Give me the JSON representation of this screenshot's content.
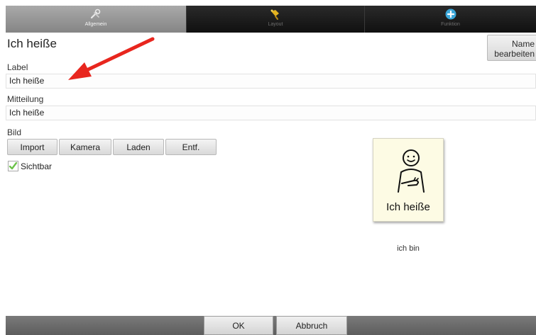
{
  "tabs": [
    {
      "label": "Allgemein",
      "icon": "tools-icon",
      "active": true
    },
    {
      "label": "Layout",
      "icon": "paint-icon",
      "active": false
    },
    {
      "label": "Funktion",
      "icon": "plus-circle-icon",
      "active": false
    }
  ],
  "header": {
    "title": "Ich heiße",
    "name_button": [
      "Name",
      "bearbeiten"
    ]
  },
  "form": {
    "label_caption": "Label",
    "label_value": "Ich heiße",
    "message_caption": "Mitteilung",
    "message_value": "Ich heiße",
    "image_caption": "Bild",
    "image_buttons": [
      "Import",
      "Kamera",
      "Laden",
      "Entf."
    ],
    "visible_label": "Sichtbar",
    "visible_checked": true
  },
  "preview": {
    "caption": "Ich heiße",
    "subtitle": "ich bin",
    "background": "#fdfbe4"
  },
  "footer": {
    "ok": "OK",
    "cancel": "Abbruch"
  },
  "colors": {
    "annotation_arrow": "#e8261e",
    "checkmark": "#6cc24a",
    "active_tab": "#999999",
    "inactive_tab": "#1c1c1c"
  }
}
